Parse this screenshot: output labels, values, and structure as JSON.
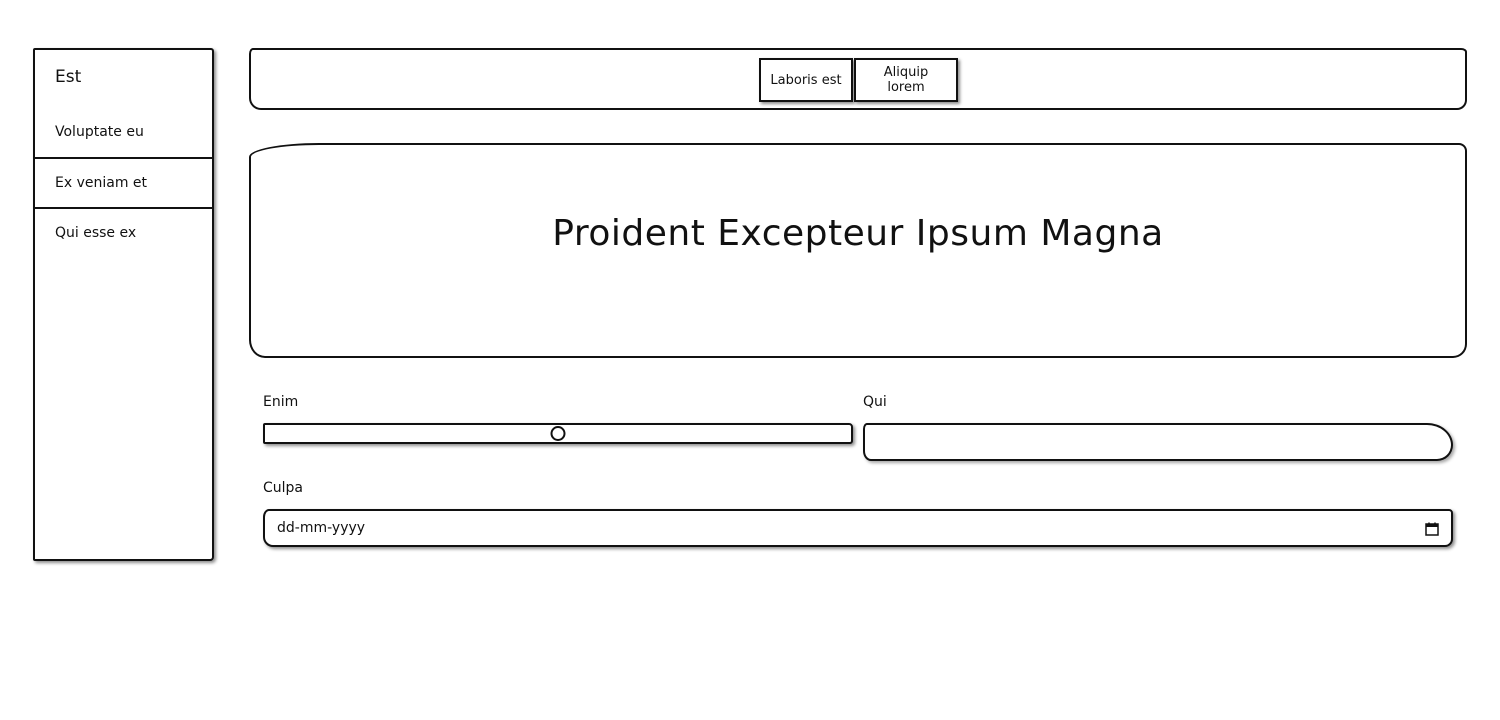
{
  "sidebar": {
    "title": "Est",
    "items": [
      {
        "label": "Voluptate eu"
      },
      {
        "label": "Ex veniam et"
      },
      {
        "label": "Qui esse ex"
      }
    ]
  },
  "header": {
    "buttons": [
      {
        "label": "Laboris est"
      },
      {
        "label": "Aliquip lorem"
      }
    ]
  },
  "hero": {
    "title": "Proident Excepteur Ipsum Magna"
  },
  "form": {
    "enim": {
      "label": "Enim",
      "value_fraction": 0.5
    },
    "qui": {
      "label": "Qui",
      "value": ""
    },
    "culpa": {
      "label": "Culpa",
      "placeholder": "dd-mm-yyyy",
      "icon": "calendar-icon"
    }
  }
}
